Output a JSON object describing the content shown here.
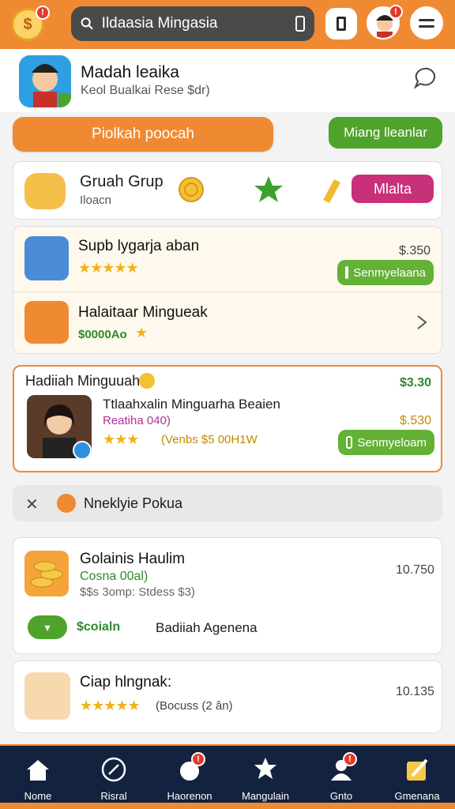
{
  "header": {
    "search_placeholder": "Ildaasia Mingasia",
    "coin_badge": "!",
    "avatar_badge": "!"
  },
  "profile": {
    "title": "Madah leaika",
    "subtitle": "Keol Bualkai Rese $dr)"
  },
  "actions": {
    "primary_label": "Piolkah poocah",
    "secondary_label": "Miang lleanlar"
  },
  "group": {
    "title": "Gruah Grup",
    "subtitle": "Iloacn",
    "more_label": "Mlalta"
  },
  "list": [
    {
      "title": "Supb lygarja aban",
      "price": "$.350",
      "button_label": "Senmyelaana",
      "rating": 4.5
    },
    {
      "title": "Halaitaar Mingueak",
      "note": "$0000Ao",
      "rating": 1
    }
  ],
  "featured": {
    "heading": "Hadiiah Minguuah",
    "heading_price": "$3.30",
    "title": "Ttlaahxalin Minguarha Beaien",
    "subtitle": "Reatiha 040)",
    "price": "$.530",
    "note": "(Venbs $5 00H1W",
    "button_label": "Senmyeloam",
    "rating": 3
  },
  "section": {
    "label": "Nneklyie Pokua"
  },
  "coins_card": {
    "title": "Golainis Haulim",
    "subtitle": "Cosna 00al)",
    "detail": "$$s 3omp: Stdess $3)",
    "value": "10.750",
    "footer_label": "Badiiah Agenena",
    "footer_green": "$coialn"
  },
  "last_card": {
    "title": "Ciap hlngnak:",
    "note": "(Bocuss (2 ân)",
    "value": "10.135",
    "rating": 4.5
  },
  "nav": [
    {
      "label": "Nome",
      "badge": ""
    },
    {
      "label": "Risral",
      "badge": ""
    },
    {
      "label": "Haorenon",
      "badge": "!"
    },
    {
      "label": "Mangulain",
      "badge": ""
    },
    {
      "label": "Gnto",
      "badge": "!"
    },
    {
      "label": "Gmenana",
      "badge": ""
    }
  ],
  "colors": {
    "accent_orange": "#f08a32",
    "green": "#4fa22a",
    "magenta": "#c9307a",
    "nav_bg": "#13233f",
    "star": "#f0b21c"
  },
  "icons": {
    "coin": "coin-icon",
    "search": "search-icon",
    "mic": "mic-icon",
    "chat": "chat-icon",
    "star": "star-icon"
  }
}
